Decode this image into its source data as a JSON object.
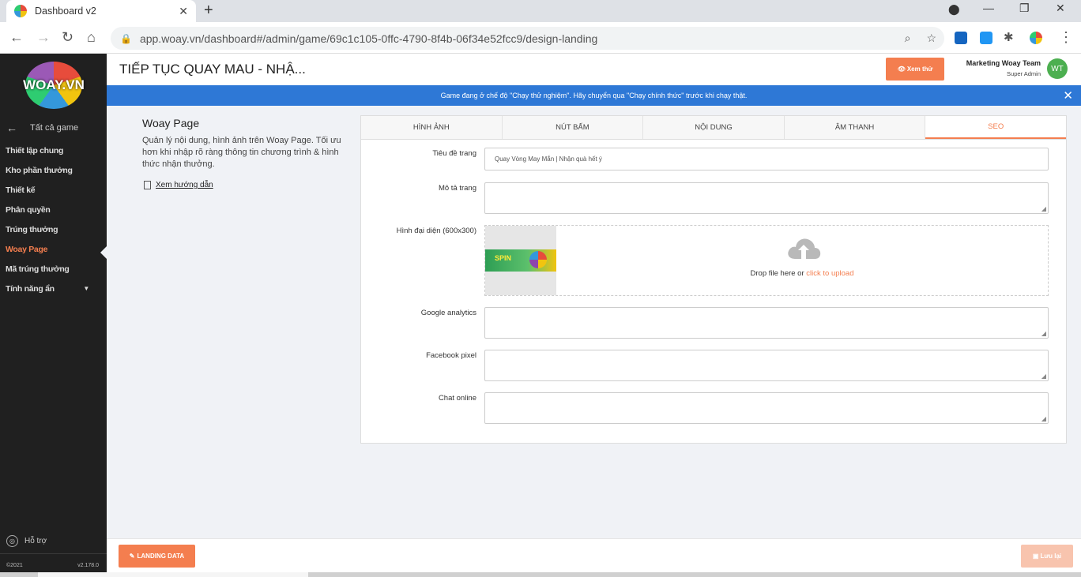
{
  "browser": {
    "tab_title": "Dashboard v2",
    "url": "app.woay.vn/dashboard#/admin/game/69c1c105-0ffc-4790-8f4b-06f34e52fcc9/design-landing"
  },
  "sidebar": {
    "logo_text": "WOAY.VN",
    "back_label": "Tất cả game",
    "items": [
      {
        "label": "Thiết lập chung"
      },
      {
        "label": "Kho phần thưởng"
      },
      {
        "label": "Thiết kế"
      },
      {
        "label": "Phân quyền"
      },
      {
        "label": "Trúng thưởng"
      },
      {
        "label": "Woay Page"
      },
      {
        "label": "Mã trúng thưởng"
      },
      {
        "label": "Tính năng ẩn"
      }
    ],
    "support_label": "Hỗ trợ",
    "copyright": "©2021",
    "version": "v2.178.0"
  },
  "header": {
    "title": "TIẾP TỤC QUAY MAU - NHẬ...",
    "preview_label": "Xem thử",
    "user_name": "Marketing Woay Team",
    "user_role": "Super Admin",
    "avatar_initials": "WT"
  },
  "notice": {
    "text": "Game đang ở chế độ \"Chạy thử nghiệm\". Hãy chuyển qua \"Chạy chính thức\" trước khi chạy thật."
  },
  "intro": {
    "title": "Woay Page",
    "description": "Quản lý nội dung, hình ảnh trên Woay Page. Tối ưu hơn khi nhập rõ ràng thông tin chương trình & hình thức nhận thưởng.",
    "guide_label": "Xem hướng dẫn"
  },
  "tabs": [
    {
      "label": "HÌNH ẢNH"
    },
    {
      "label": "NÚT BẤM"
    },
    {
      "label": "NỘI DUNG"
    },
    {
      "label": "ÂM THANH"
    },
    {
      "label": "SEO"
    }
  ],
  "form": {
    "page_title_label": "Tiêu đề trang",
    "page_title_value": "Quay Vòng May Mắn | Nhận quà hết ý",
    "description_label": "Mô tả trang",
    "description_value": "",
    "image_label": "Hình đại diện (600x300)",
    "banner_text": "SPIN",
    "drop_text": "Drop file here or",
    "drop_link": "click to upload",
    "ga_label": "Google analytics",
    "ga_value": "",
    "fb_label": "Facebook pixel",
    "fb_value": "",
    "chat_label": "Chat online",
    "chat_value": ""
  },
  "footer": {
    "landing_label": "LANDING DATA",
    "save_label": "Lưu lại"
  },
  "colors": {
    "accent": "#f47e4f",
    "notice": "#2e78d6",
    "sidebar": "#202020"
  }
}
